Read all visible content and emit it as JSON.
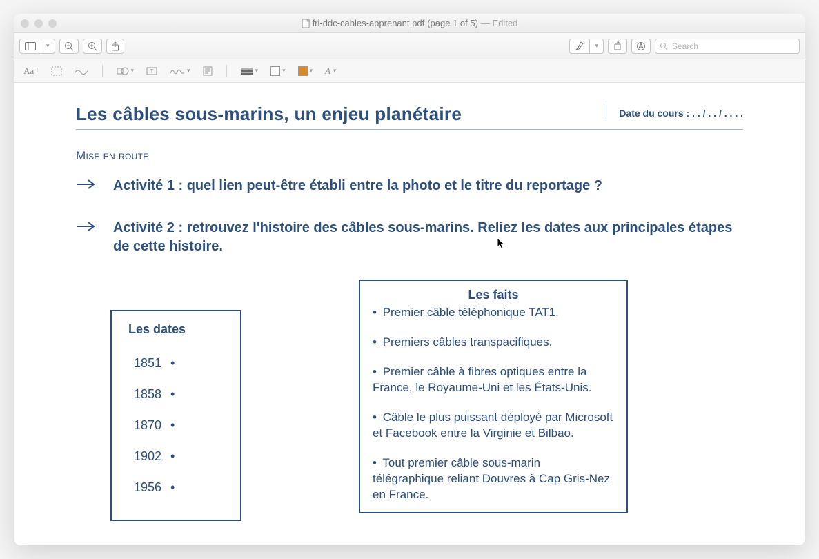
{
  "window": {
    "filename": "fri-ddc-cables-apprenant.pdf",
    "page_info": "(page 1 of 5)",
    "status": "— Edited"
  },
  "toolbar": {
    "search_placeholder": "Search"
  },
  "document": {
    "title": "Les câbles sous-marins, un enjeu planétaire",
    "date_label": "Date du cours : . . / . . / . . . .",
    "section_heading": "Mise en route",
    "activity1": "Activité 1 : quel lien peut-être établi entre la photo et le titre du reportage ?",
    "activity2": "Activité 2 : retrouvez l'histoire des câbles sous-marins. Reliez les dates aux principales étapes de cette histoire.",
    "dates_title": "Les dates",
    "dates": [
      "1851",
      "1858",
      "1870",
      "1902",
      "1956"
    ],
    "facts_title": "Les faits",
    "facts": [
      "Premier câble téléphonique TAT1.",
      "Premiers câbles transpacifiques.",
      "Premier câble à fibres optiques entre la France, le Royaume-Uni et les États-Unis.",
      "Câble le plus puissant déployé par Microsoft et Facebook entre la Virginie et Bilbao.",
      "Tout premier câble sous-marin télégraphique reliant Douvres à Cap Gris-Nez en France."
    ]
  }
}
